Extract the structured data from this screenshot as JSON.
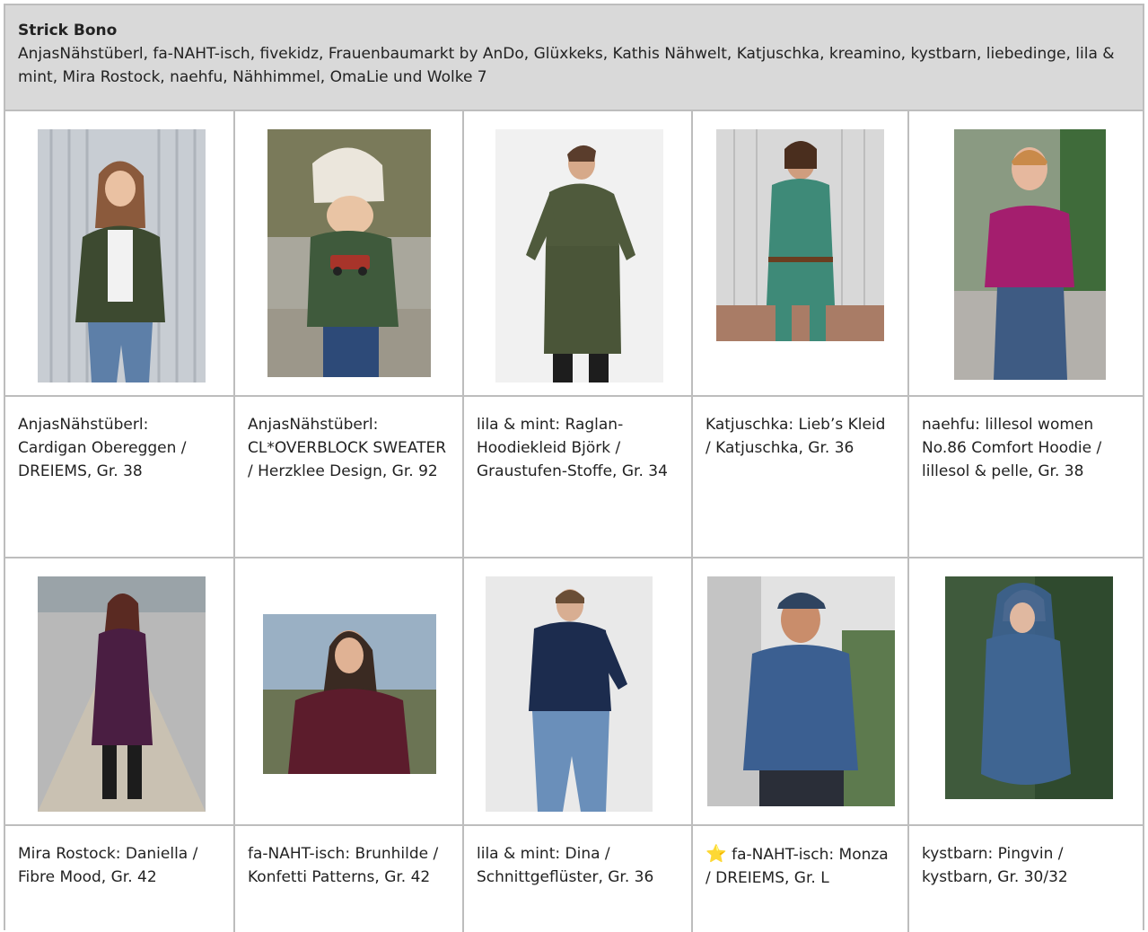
{
  "header": {
    "title": "Strick Bono",
    "text": "AnjasNähstüberl, fa-NAHT-isch, fivekidz, Frauenbaumarkt by AnDo, Glüxkeks, Kathis Nähwelt, Katjuschka, kreamino, kystbarn, liebedinge, lila & mint, Mira Rostock, naehfu, Nähhimmel, OmaLie und Wolke 7"
  },
  "row1": [
    {
      "caption": "AnjasNähstüberl: Cardigan Obereggen / DREIEMS, Gr. 38",
      "photo": "woman in dark green cardigan and jeans"
    },
    {
      "caption": "AnjasNähstüberl: CL*OVERBLOCK SWEATER / Herzklee Design, Gr. 92",
      "photo": "child in beanie and green sweater with fire truck"
    },
    {
      "caption": "lila & mint: Raglan-Hoodiekleid Björk / Graustufen-Stoffe, Gr. 34",
      "photo": "woman in olive green hoodie dress"
    },
    {
      "caption": "Katjuschka: Lieb’s Kleid / Katjuschka, Gr. 36",
      "photo": "woman in mint green dress with belt"
    },
    {
      "caption": "naehfu: lillesol women No.86 Comfort Hoodie / lillesol & pelle, Gr. 38",
      "photo": "woman in magenta sweater and denim skirt"
    }
  ],
  "row2": [
    {
      "caption": "Mira Rostock: Daniella / Fibre Mood, Gr. 42",
      "photo": "woman in purple sweater dress on path"
    },
    {
      "caption": "fa-NAHT-isch: Brunhilde / Konfetti Patterns, Gr. 42",
      "photo": "woman in burgundy sweater outdoors"
    },
    {
      "caption": "lila & mint: Dina / Schnittgeflüster, Gr. 36",
      "photo": "woman in navy turtleneck sweater"
    },
    {
      "star": "⭐",
      "caption": "fa-NAHT-isch: Monza / DREIEMS, Gr. L",
      "photo": "man in blue turtleneck sweater and cap"
    },
    {
      "caption": "kystbarn: Pingvin / kystbarn, Gr. 30/32",
      "photo": "woman in blue hooded tunic"
    }
  ],
  "colors": {
    "header_bg": "#d9d9d9",
    "grid_border": "#bdbdbd",
    "star": "#f4c20d"
  }
}
